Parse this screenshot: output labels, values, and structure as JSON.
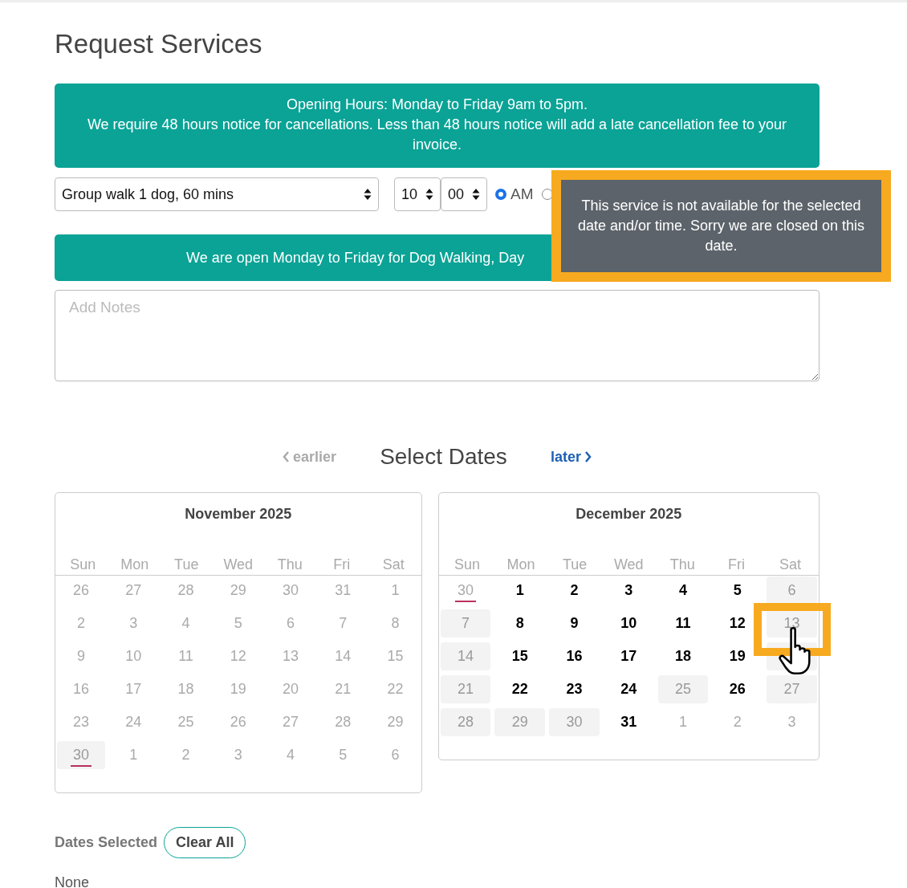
{
  "title": "Request Services",
  "notice": {
    "lines": [
      "Opening Hours: Monday to Friday 9am to 5pm.",
      "We require 48 hours notice for cancellations. Less than 48 hours notice will add a late cancellation fee to your invoice."
    ]
  },
  "service_select": {
    "value": "Group walk 1 dog, 60 mins"
  },
  "hour_select": {
    "value": "10"
  },
  "minute_select": {
    "value": "00"
  },
  "meridiem": [
    {
      "label": "AM",
      "selected": true
    },
    {
      "selected": false
    }
  ],
  "availability_banner": {
    "text": "We are open Monday to Friday for Dog Walking, Day"
  },
  "notes": {
    "placeholder": "Add Notes"
  },
  "tooltip": {
    "text": "This service is not available for the selected date and/or time. Sorry we are closed on this date."
  },
  "date_nav": {
    "earlier": "earlier",
    "title": "Select Dates",
    "later": "later",
    "earlier_disabled": true
  },
  "calendars": [
    {
      "month": "November 2025",
      "weekdays": [
        "Sun",
        "Mon",
        "Tue",
        "Wed",
        "Thu",
        "Fri",
        "Sat"
      ],
      "days": [
        {
          "label": "26",
          "kind": "past",
          "today": false
        },
        {
          "label": "27",
          "kind": "past",
          "today": false
        },
        {
          "label": "28",
          "kind": "past",
          "today": false
        },
        {
          "label": "29",
          "kind": "past",
          "today": false
        },
        {
          "label": "30",
          "kind": "past",
          "today": false
        },
        {
          "label": "31",
          "kind": "past",
          "today": false
        },
        {
          "label": "1",
          "kind": "past",
          "today": false
        },
        {
          "label": "2",
          "kind": "past",
          "today": false
        },
        {
          "label": "3",
          "kind": "past",
          "today": false
        },
        {
          "label": "4",
          "kind": "past",
          "today": false
        },
        {
          "label": "5",
          "kind": "past",
          "today": false
        },
        {
          "label": "6",
          "kind": "past",
          "today": false
        },
        {
          "label": "7",
          "kind": "past",
          "today": false
        },
        {
          "label": "8",
          "kind": "past",
          "today": false
        },
        {
          "label": "9",
          "kind": "past",
          "today": false
        },
        {
          "label": "10",
          "kind": "past",
          "today": false
        },
        {
          "label": "11",
          "kind": "past",
          "today": false
        },
        {
          "label": "12",
          "kind": "past",
          "today": false
        },
        {
          "label": "13",
          "kind": "past",
          "today": false
        },
        {
          "label": "14",
          "kind": "past",
          "today": false
        },
        {
          "label": "15",
          "kind": "past",
          "today": false
        },
        {
          "label": "16",
          "kind": "past",
          "today": false
        },
        {
          "label": "17",
          "kind": "past",
          "today": false
        },
        {
          "label": "18",
          "kind": "past",
          "today": false
        },
        {
          "label": "19",
          "kind": "past",
          "today": false
        },
        {
          "label": "20",
          "kind": "past",
          "today": false
        },
        {
          "label": "21",
          "kind": "past",
          "today": false
        },
        {
          "label": "22",
          "kind": "past",
          "today": false
        },
        {
          "label": "23",
          "kind": "past",
          "today": false
        },
        {
          "label": "24",
          "kind": "past",
          "today": false
        },
        {
          "label": "25",
          "kind": "past",
          "today": false
        },
        {
          "label": "26",
          "kind": "past",
          "today": false
        },
        {
          "label": "27",
          "kind": "past",
          "today": false
        },
        {
          "label": "28",
          "kind": "past",
          "today": false
        },
        {
          "label": "29",
          "kind": "past",
          "today": false
        },
        {
          "label": "30",
          "kind": "closed",
          "today": true
        },
        {
          "label": "1",
          "kind": "past",
          "today": false
        },
        {
          "label": "2",
          "kind": "past",
          "today": false
        },
        {
          "label": "3",
          "kind": "past",
          "today": false
        },
        {
          "label": "4",
          "kind": "past",
          "today": false
        },
        {
          "label": "5",
          "kind": "past",
          "today": false
        },
        {
          "label": "6",
          "kind": "past",
          "today": false
        }
      ]
    },
    {
      "month": "December 2025",
      "weekdays": [
        "Sun",
        "Mon",
        "Tue",
        "Wed",
        "Thu",
        "Fri",
        "Sat"
      ],
      "days": [
        {
          "label": "30",
          "kind": "past",
          "today": true
        },
        {
          "label": "1",
          "kind": "open",
          "today": false
        },
        {
          "label": "2",
          "kind": "open",
          "today": false
        },
        {
          "label": "3",
          "kind": "open",
          "today": false
        },
        {
          "label": "4",
          "kind": "open",
          "today": false
        },
        {
          "label": "5",
          "kind": "open",
          "today": false
        },
        {
          "label": "6",
          "kind": "closed",
          "today": false
        },
        {
          "label": "7",
          "kind": "closed",
          "today": false
        },
        {
          "label": "8",
          "kind": "open",
          "today": false
        },
        {
          "label": "9",
          "kind": "open",
          "today": false
        },
        {
          "label": "10",
          "kind": "open",
          "today": false
        },
        {
          "label": "11",
          "kind": "open",
          "today": false
        },
        {
          "label": "12",
          "kind": "open",
          "today": false
        },
        {
          "label": "13",
          "kind": "closed",
          "today": false
        },
        {
          "label": "14",
          "kind": "closed",
          "today": false
        },
        {
          "label": "15",
          "kind": "open",
          "today": false
        },
        {
          "label": "16",
          "kind": "open",
          "today": false
        },
        {
          "label": "17",
          "kind": "open",
          "today": false
        },
        {
          "label": "18",
          "kind": "open",
          "today": false
        },
        {
          "label": "19",
          "kind": "open",
          "today": false
        },
        {
          "kind": "closed",
          "today": false
        },
        {
          "label": "21",
          "kind": "closed",
          "today": false
        },
        {
          "label": "22",
          "kind": "open",
          "today": false
        },
        {
          "label": "23",
          "kind": "open",
          "today": false
        },
        {
          "label": "24",
          "kind": "open",
          "today": false
        },
        {
          "label": "25",
          "kind": "closed",
          "today": false
        },
        {
          "label": "26",
          "kind": "open",
          "today": false
        },
        {
          "label": "27",
          "kind": "closed",
          "today": false
        },
        {
          "label": "28",
          "kind": "closed",
          "today": false
        },
        {
          "label": "29",
          "kind": "closed",
          "today": false
        },
        {
          "label": "30",
          "kind": "closed",
          "today": false
        },
        {
          "label": "31",
          "kind": "open",
          "today": false
        },
        {
          "label": "1",
          "kind": "past",
          "today": false
        },
        {
          "label": "2",
          "kind": "past",
          "today": false
        },
        {
          "label": "3",
          "kind": "past",
          "today": false
        }
      ]
    }
  ],
  "dates_selected": {
    "label": "Dates Selected",
    "clear_button": "Clear All",
    "value": "None"
  }
}
